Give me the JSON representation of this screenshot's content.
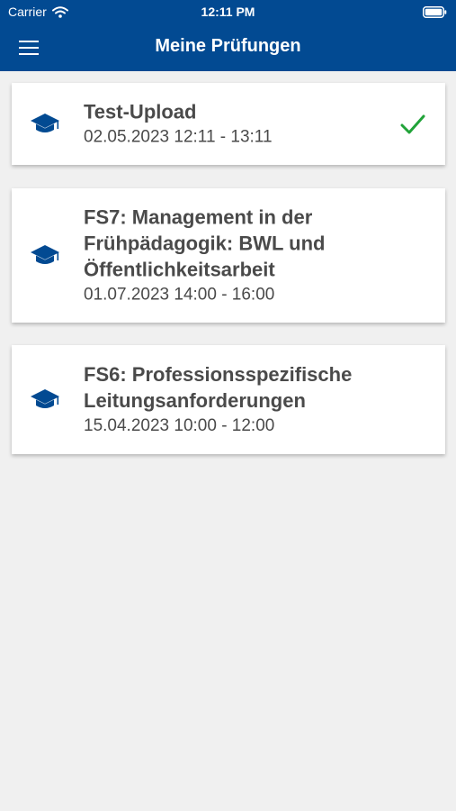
{
  "status_bar": {
    "carrier": "Carrier",
    "time": "12:11 PM"
  },
  "nav": {
    "title": "Meine Prüfungen",
    "menu_icon": "hamburger-menu-icon"
  },
  "colors": {
    "header_bg": "#024a92",
    "icon_blue": "#024a92",
    "check_green": "#21a339",
    "text": "#4a4a4a",
    "background": "#f0f0f0"
  },
  "exams": [
    {
      "title": "Test-Upload",
      "date": "02.05.2023 12:11 - 13:11",
      "icon": "graduation-cap-icon",
      "completed": true
    },
    {
      "title_lines": [
        "FS7: Management in der",
        "Frühpädagogik: BWL und",
        "Öffentlichkeitsarbeit"
      ],
      "date": "01.07.2023 14:00 - 16:00",
      "icon": "graduation-cap-icon",
      "completed": false
    },
    {
      "title_lines": [
        "FS6: Professionsspezifische",
        "Leitungsanforderungen"
      ],
      "date": "15.04.2023 10:00 - 12:00",
      "icon": "graduation-cap-icon",
      "completed": false
    }
  ]
}
